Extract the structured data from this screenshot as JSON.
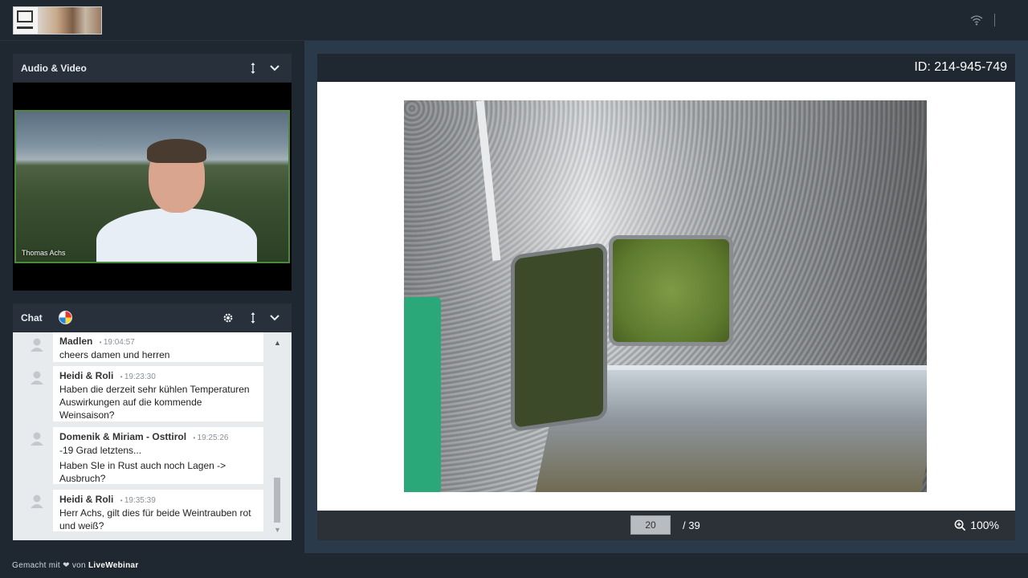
{
  "header": {
    "logo_alt": "logo",
    "wifi_icon": "wifi-icon"
  },
  "av_panel": {
    "title": "Audio & Video",
    "video_participant": "Thomas Achs"
  },
  "chat_panel": {
    "title": "Chat",
    "messages": [
      {
        "author": "Madlen",
        "time": "19:04:57",
        "lines": [
          "cheers damen und herren"
        ]
      },
      {
        "author": "Heidi & Roli",
        "time": "19:23:30",
        "lines": [
          "Haben die derzeit sehr kühlen Temperaturen Auswirkungen auf die kommende Weinsaison?"
        ]
      },
      {
        "author": "Domenik & Miriam - Osttirol",
        "time": "19:25:26",
        "lines": [
          "-19 Grad letztens...",
          "Haben SIe in Rust auch noch Lagen -> Ausbruch?"
        ]
      },
      {
        "author": "Heidi & Roli",
        "time": "19:35:39",
        "lines": [
          "Herr Achs, gilt dies für beide Weintrauben rot und weiß?"
        ]
      }
    ]
  },
  "footer": {
    "prefix": "Gemacht mit",
    "middle": "von",
    "brand": "LiveWebinar"
  },
  "presentation": {
    "id_label": "ID: 214-945-749",
    "current_page": "20",
    "total_pages": "/ 39",
    "zoom": "100%"
  },
  "colors": {
    "background": "#1f2730",
    "panel_header": "#28313b",
    "video_border": "#4a8a3a",
    "main_area": "#2a3a4a"
  }
}
